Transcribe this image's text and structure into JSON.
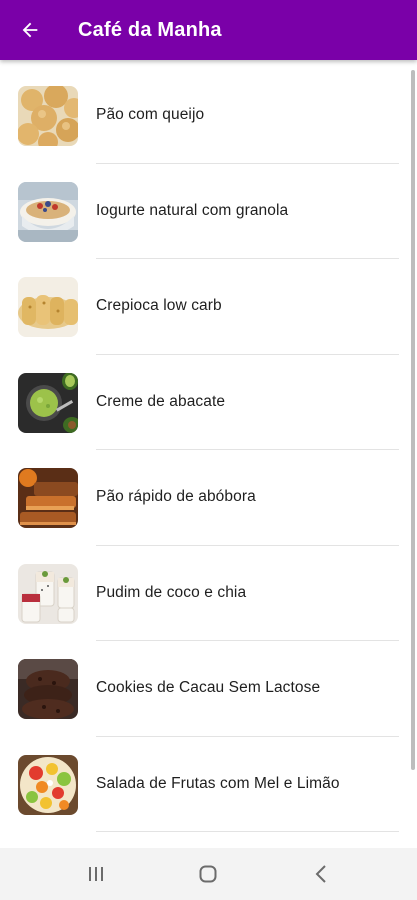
{
  "app_bar": {
    "title": "Café da Manha",
    "background": "#7a00a8",
    "back_icon": "arrow-left-icon"
  },
  "recipes": [
    {
      "label": "Pão com queijo",
      "icon": "cheese-bread-thumbnail"
    },
    {
      "label": "Iogurte natural com granola",
      "icon": "yogurt-granola-thumbnail"
    },
    {
      "label": "Crepioca low carb",
      "icon": "crepioca-thumbnail"
    },
    {
      "label": "Creme de abacate",
      "icon": "avocado-cream-thumbnail"
    },
    {
      "label": "Pão rápido de abóbora",
      "icon": "pumpkin-bread-thumbnail"
    },
    {
      "label": "Pudim de coco e chia",
      "icon": "coconut-chia-pudding-thumbnail"
    },
    {
      "label": "Cookies de Cacau Sem Lactose",
      "icon": "cocoa-cookies-thumbnail"
    },
    {
      "label": "Salada de Frutas com Mel e Limão",
      "icon": "fruit-salad-thumbnail"
    }
  ],
  "nav_bar": {
    "recents_icon": "recents-icon",
    "home_icon": "home-icon",
    "back_icon": "back-chevron-icon"
  }
}
